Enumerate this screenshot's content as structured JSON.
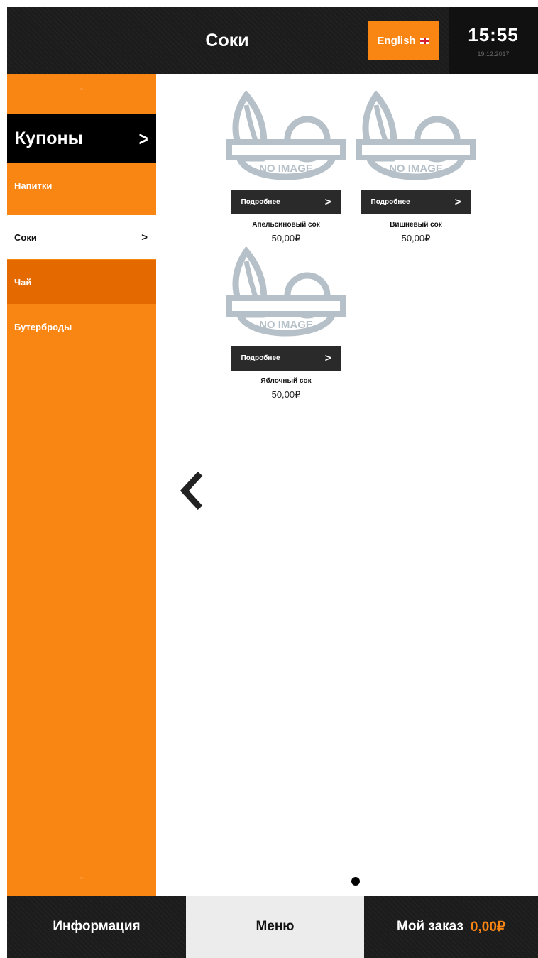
{
  "header": {
    "title": "Соки",
    "language_button": "English",
    "time": "15:55",
    "date": "19.12.2017"
  },
  "sidebar": {
    "coupons_label": "Купоны",
    "categories": [
      {
        "label": "Напитки",
        "state": "normal"
      },
      {
        "label": "Соки",
        "state": "active"
      },
      {
        "label": "Чай",
        "state": "sub"
      },
      {
        "label": "Бутерброды",
        "state": "normal"
      }
    ]
  },
  "products": [
    {
      "name": "Апельсиновый сок",
      "price": "50,00₽",
      "button": "Подробнее",
      "image_text": "NO IMAGE"
    },
    {
      "name": "Вишневый сок",
      "price": "50,00₽",
      "button": "Подробнее",
      "image_text": "NO IMAGE"
    },
    {
      "name": "Яблочный сок",
      "price": "50,00₽",
      "button": "Подробнее",
      "image_text": "NO IMAGE"
    }
  ],
  "footer": {
    "info_label": "Информация",
    "menu_label": "Меню",
    "order_label": "Мой заказ",
    "order_total": "0,00₽"
  },
  "colors": {
    "accent": "#f98513",
    "dark": "#1c1c1c",
    "sub_category": "#e46a00"
  }
}
